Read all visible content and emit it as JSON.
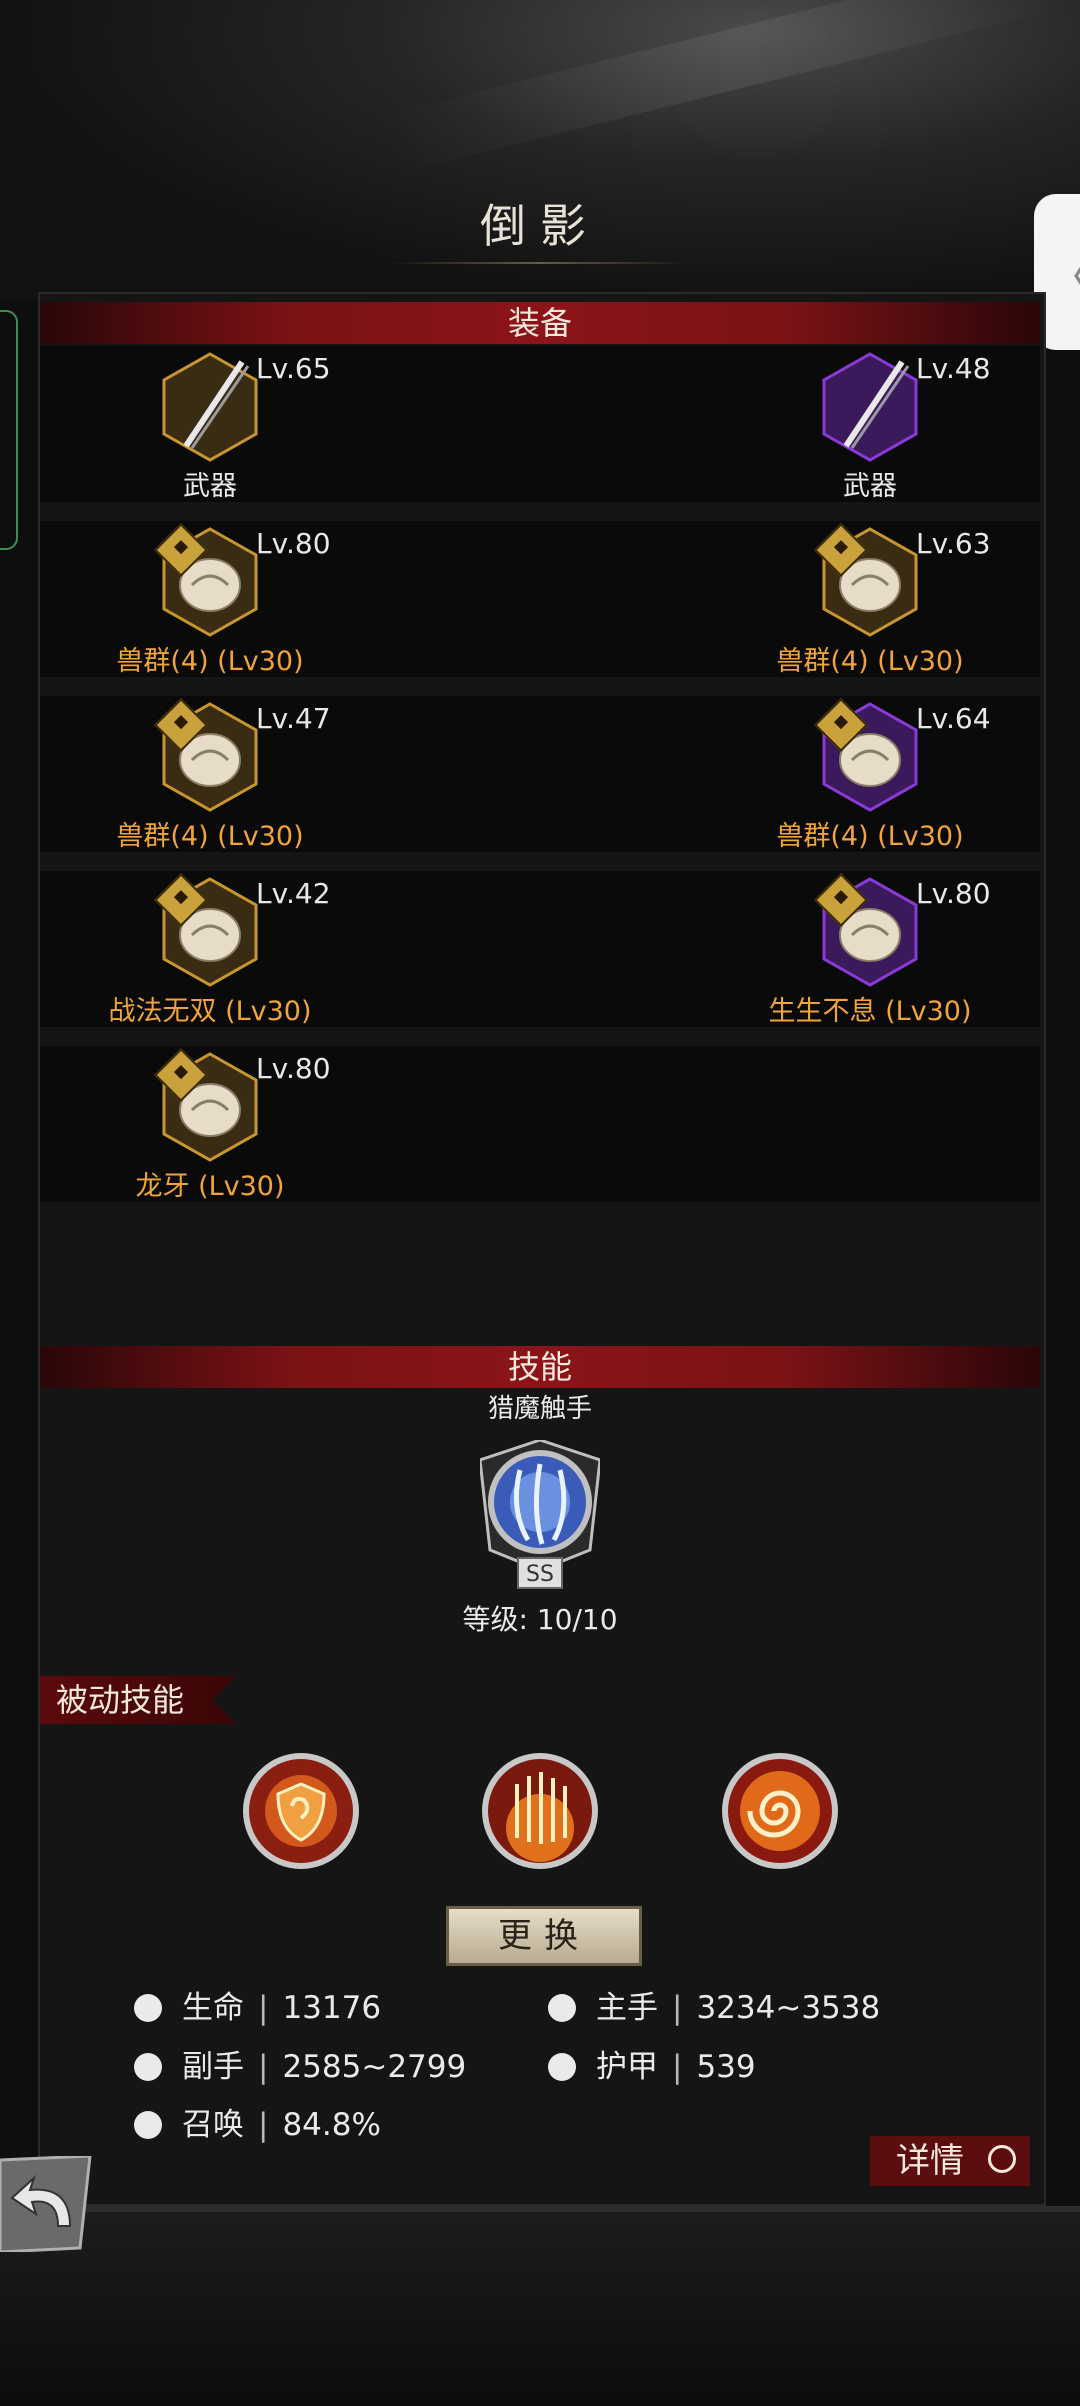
{
  "page": {
    "title": "倒影"
  },
  "sections": {
    "equipment": "装备",
    "skills": "技能"
  },
  "equipment": [
    {
      "level": "Lv.65",
      "name": "武器",
      "tier": "gold",
      "name_color": "white"
    },
    {
      "level": "Lv.48",
      "name": "武器",
      "tier": "purple",
      "name_color": "white"
    },
    {
      "level": "Lv.80",
      "name": "兽群(4) (Lv30)",
      "tier": "gold",
      "name_color": "gold"
    },
    {
      "level": "Lv.63",
      "name": "兽群(4) (Lv30)",
      "tier": "gold",
      "name_color": "gold"
    },
    {
      "level": "Lv.47",
      "name": "兽群(4) (Lv30)",
      "tier": "gold",
      "name_color": "gold"
    },
    {
      "level": "Lv.64",
      "name": "兽群(4) (Lv30)",
      "tier": "purple",
      "name_color": "gold"
    },
    {
      "level": "Lv.42",
      "name": "战法无双 (Lv30)",
      "tier": "gold",
      "name_color": "gold"
    },
    {
      "level": "Lv.80",
      "name": "生生不息 (Lv30)",
      "tier": "purple",
      "name_color": "gold"
    },
    {
      "level": "Lv.80",
      "name": "龙牙 (Lv30)",
      "tier": "gold",
      "name_color": "gold"
    }
  ],
  "skill": {
    "name": "猎魔触手",
    "grade": "SS",
    "level_text": "等级: 10/10"
  },
  "passive": {
    "label": "被动技能",
    "icons": [
      "shield-swirl-icon",
      "blade-rain-icon",
      "vortex-icon"
    ]
  },
  "change_button": "更换",
  "stats": {
    "life": {
      "label": "生命",
      "value": "13176"
    },
    "main_hand": {
      "label": "主手",
      "value": "3234~3538"
    },
    "off_hand": {
      "label": "副手",
      "value": "2585~2799"
    },
    "armor": {
      "label": "护甲",
      "value": "539"
    },
    "summon": {
      "label": "召唤",
      "value": "84.8%"
    }
  },
  "detail_button": "详情",
  "colors": {
    "accent_red": "#8c1418",
    "gold": "#f0a43a",
    "purple": "#8a3ad8"
  }
}
